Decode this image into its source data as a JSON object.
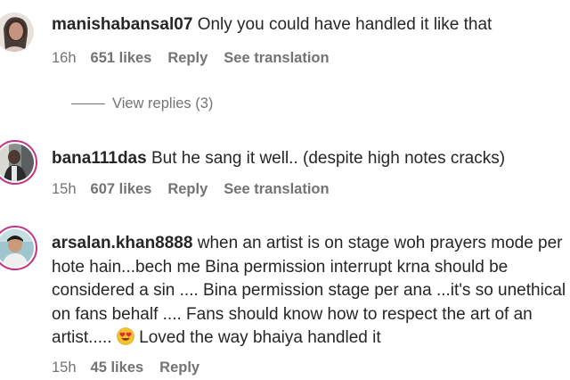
{
  "comments": [
    {
      "username": "manishabansal07",
      "text": "Only you could have handled it like that",
      "time": "16h",
      "likes": "651 likes",
      "reply": "Reply",
      "translation": "See translation",
      "view_replies": "View replies (3)"
    },
    {
      "username": "bana111das",
      "text": "But he sang it well.. (despite high notes cracks)",
      "time": "15h",
      "likes": "607 likes",
      "reply": "Reply",
      "translation": "See translation"
    },
    {
      "username": "arsalan.khan8888",
      "text_before_emoji": "when an artist is on stage woh prayers mode per hote hain...bech me Bina permission interrupt krna should be considered a sin .... Bina permission stage per ana ...it's so unethical on fans behalf .... Fans should know how to respect the art of an artist.....",
      "text_after_emoji": "Loved the way bhaiya handled it",
      "emoji": "heart-eyes-emoji",
      "time": "15h",
      "likes": "45 likes",
      "reply": "Reply"
    }
  ],
  "colors": {
    "text": "#262626",
    "secondary": "#737373",
    "story_ring": "#c13584"
  }
}
